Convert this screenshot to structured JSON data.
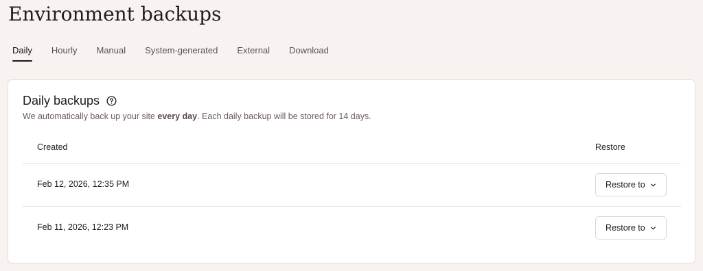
{
  "page": {
    "title": "Environment backups"
  },
  "tabs": [
    {
      "label": "Daily",
      "active": true
    },
    {
      "label": "Hourly",
      "active": false
    },
    {
      "label": "Manual",
      "active": false
    },
    {
      "label": "System-generated",
      "active": false
    },
    {
      "label": "External",
      "active": false
    },
    {
      "label": "Download",
      "active": false
    }
  ],
  "card": {
    "title": "Daily backups",
    "help_icon": "help-circle-icon",
    "desc_before": "We automatically back up your site ",
    "desc_bold": "every day",
    "desc_after": ". Each daily backup will be stored for 14 days."
  },
  "table": {
    "headers": {
      "created": "Created",
      "restore": "Restore"
    },
    "rows": [
      {
        "created": "Feb 12, 2026, 12:35 PM",
        "action_label": "Restore to",
        "action_icon": "chevron-down-icon"
      },
      {
        "created": "Feb 11, 2026, 12:23 PM",
        "action_label": "Restore to",
        "action_icon": "chevron-down-icon"
      }
    ]
  },
  "colors": {
    "page_background": "#f8f3f1",
    "card_background": "#ffffff",
    "active_tab_underline": "#1a1515"
  }
}
